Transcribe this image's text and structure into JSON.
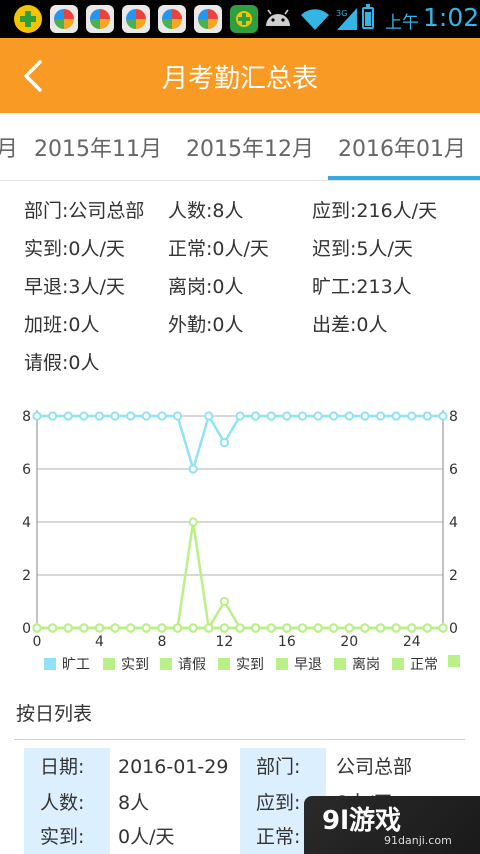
{
  "status_bar": {
    "ampm": "上午",
    "time": "1:02",
    "network": "3G",
    "icons": [
      "plus-app-icon",
      "game-ball-icon",
      "game-ball-icon",
      "game-ball-icon",
      "game-ball-icon",
      "game-ball-icon",
      "plus-app-icon",
      "android-icon",
      "wifi-icon",
      "signal-icon",
      "battery-icon"
    ]
  },
  "header": {
    "title": "月考勤汇总表",
    "back_icon": "chevron-left-icon",
    "color": "#f89a23"
  },
  "tabs": {
    "partial": "月",
    "items": [
      "2015年11月",
      "2015年12月",
      "2016年01月"
    ],
    "selected": "2016年01月",
    "accent": "#33a9e2"
  },
  "summary": {
    "department": "部门:公司总部",
    "headcount": "人数:8人",
    "should_attend": "应到:216人/天",
    "actual": "实到:0人/天",
    "normal": "正常:0人/天",
    "late": "迟到:5人/天",
    "early_leave": "早退:3人/天",
    "absent_post": "离岗:0人",
    "absenteeism": "旷工:213人",
    "overtime": "加班:0人",
    "field_work": "外勤:0人",
    "business_trip": "出差:0人",
    "leave": "请假:0人"
  },
  "chart_data": {
    "type": "line",
    "x": [
      0,
      1,
      2,
      3,
      4,
      5,
      6,
      7,
      8,
      9,
      10,
      11,
      12,
      13,
      14,
      15,
      16,
      17,
      18,
      19,
      20,
      21,
      22,
      23,
      24,
      25,
      26
    ],
    "x_ticks": [
      "0",
      "4",
      "8",
      "12",
      "16",
      "20",
      "24"
    ],
    "y_ticks": [
      "0",
      "2",
      "4",
      "6",
      "8"
    ],
    "ylim": [
      0,
      8
    ],
    "xlim": [
      0,
      26
    ],
    "grid": true,
    "legend_position": "bottom",
    "series": [
      {
        "name": "旷工",
        "color": "#8fe3f5",
        "values": [
          8,
          8,
          8,
          8,
          8,
          8,
          8,
          8,
          8,
          8,
          6,
          8,
          7,
          8,
          8,
          8,
          8,
          8,
          8,
          8,
          8,
          8,
          8,
          8,
          8,
          8,
          8
        ]
      },
      {
        "name": "实到",
        "color": "#b9f088",
        "values": [
          0,
          0,
          0,
          0,
          0,
          0,
          0,
          0,
          0,
          0,
          4,
          0,
          1,
          0,
          0,
          0,
          0,
          0,
          0,
          0,
          0,
          0,
          0,
          0,
          0,
          0,
          0
        ]
      },
      {
        "name": "请假",
        "color": "#b9f088",
        "values": [
          0,
          0,
          0,
          0,
          0,
          0,
          0,
          0,
          0,
          0,
          0,
          0,
          0,
          0,
          0,
          0,
          0,
          0,
          0,
          0,
          0,
          0,
          0,
          0,
          0,
          0,
          0
        ]
      },
      {
        "name": "实到",
        "color": "#b9f088",
        "values": [
          0,
          0,
          0,
          0,
          0,
          0,
          0,
          0,
          0,
          0,
          0,
          0,
          0,
          0,
          0,
          0,
          0,
          0,
          0,
          0,
          0,
          0,
          0,
          0,
          0,
          0,
          0
        ]
      },
      {
        "name": "早退",
        "color": "#b9f088",
        "values": [
          0,
          0,
          0,
          0,
          0,
          0,
          0,
          0,
          0,
          0,
          0,
          0,
          0,
          0,
          0,
          0,
          0,
          0,
          0,
          0,
          0,
          0,
          0,
          0,
          0,
          0,
          0
        ]
      },
      {
        "name": "离岗",
        "color": "#b9f088",
        "values": [
          0,
          0,
          0,
          0,
          0,
          0,
          0,
          0,
          0,
          0,
          0,
          0,
          0,
          0,
          0,
          0,
          0,
          0,
          0,
          0,
          0,
          0,
          0,
          0,
          0,
          0,
          0
        ]
      },
      {
        "name": "正常",
        "color": "#b9f088",
        "values": [
          0,
          0,
          0,
          0,
          0,
          0,
          0,
          0,
          0,
          0,
          0,
          0,
          0,
          0,
          0,
          0,
          0,
          0,
          0,
          0,
          0,
          0,
          0,
          0,
          0,
          0,
          0
        ]
      }
    ]
  },
  "daily_list": {
    "title": "按日列表",
    "label_bg": "#dcefff",
    "rows": [
      {
        "l1": "日期:",
        "v1": "2016-01-29",
        "l2": "部门:",
        "v2": "公司总部"
      },
      {
        "l1": "人数:",
        "v1": "8人",
        "l2": "应到:",
        "v2": "8人/天"
      },
      {
        "l1": "实到:",
        "v1": "0人/天",
        "l2": "正常:",
        "v2": ""
      }
    ]
  },
  "watermark": {
    "main": "9l游戏",
    "sub": "91danji.com"
  }
}
